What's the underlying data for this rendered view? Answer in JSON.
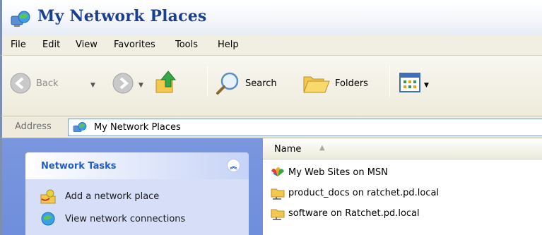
{
  "window": {
    "title": "My Network Places"
  },
  "menu": [
    "File",
    "Edit",
    "View",
    "Favorites",
    "Tools",
    "Help"
  ],
  "toolbar": {
    "back_label": "Back",
    "search_label": "Search",
    "folders_label": "Folders"
  },
  "address": {
    "label": "Address",
    "value": "My Network Places"
  },
  "task_pane": {
    "title": "Network Tasks",
    "items": [
      {
        "label": "Add a network place",
        "icon": "add-network-place-icon"
      },
      {
        "label": "View network connections",
        "icon": "network-connections-icon"
      }
    ]
  },
  "list": {
    "column_name": "Name",
    "items": [
      {
        "label": "My Web Sites on MSN",
        "icon": "msn-icon"
      },
      {
        "label": "product_docs on ratchet.pd.local",
        "icon": "network-folder-icon"
      },
      {
        "label": "software on Ratchet.pd.local",
        "icon": "network-folder-icon"
      }
    ]
  },
  "colors": {
    "title_text": "#1b3f8f",
    "task_link": "#215dc6",
    "task_pane_bg": "#7a96df"
  }
}
